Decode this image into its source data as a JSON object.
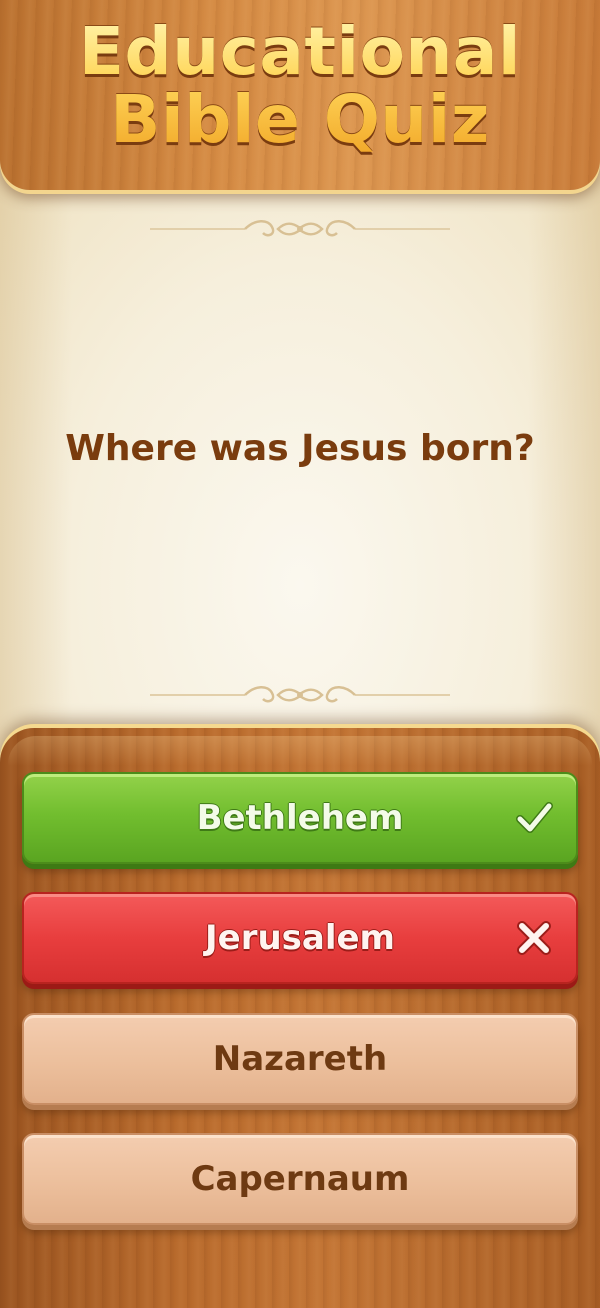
{
  "header": {
    "title_line1": "Educational",
    "title_line2": "Bible Quiz"
  },
  "question": {
    "text": "Where was Jesus born?"
  },
  "answers": [
    {
      "label": "Bethlehem",
      "state": "correct",
      "icon": "checkmark-icon"
    },
    {
      "label": "Jerusalem",
      "state": "wrong",
      "icon": "close-x-icon"
    },
    {
      "label": "Nazareth",
      "state": "neutral"
    },
    {
      "label": "Capernaum",
      "state": "neutral"
    }
  ],
  "colors": {
    "correct": "#72be2f",
    "wrong": "#e83e3e",
    "neutral": "#ecbf9c",
    "question_text": "#7a3c0e",
    "title_gold": "#ffd35a",
    "wood": "#c27434"
  }
}
